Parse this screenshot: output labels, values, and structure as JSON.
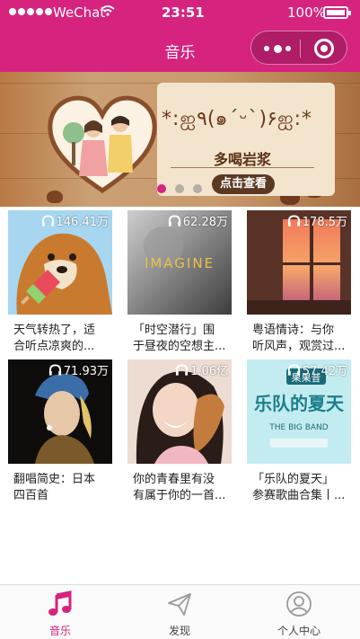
{
  "status_bar": {
    "carrier": "WeChat",
    "time": "23:51",
    "battery": "100%"
  },
  "nav": {
    "title": "音乐"
  },
  "banner": {
    "kaomoji": "*:ஐ٩(๑´ᵕ`)۶ஐ:*",
    "slogan": "多喝岩浆",
    "cta": "点击查看",
    "dots_total": 3,
    "dot_active": 0
  },
  "playlists": [
    {
      "count": "146.41万",
      "line1": "天气转热了，适",
      "line2": "合听点凉爽的...",
      "cover": "dog-popsicle"
    },
    {
      "count": "62.28万",
      "line1": "「时空潜行」围",
      "line2": "于昼夜的空想主...",
      "cover": "imagine-bw"
    },
    {
      "count": "178.5万",
      "line1": "粤语情诗：与你",
      "line2": "听风声，观赏过...",
      "cover": "sunset-window"
    },
    {
      "count": "71.93万",
      "line1": "翻唱简史：日本",
      "line2": "四百首",
      "cover": "pearl-earring"
    },
    {
      "count": "1.06亿",
      "line1": "你的青春里有没",
      "line2": "有属于你的一首...",
      "cover": "girl-laughing"
    },
    {
      "count": "57.42万",
      "line1": "「乐队的夏天」",
      "line2": "参赛歌曲合集丨...",
      "cover": "big-band"
    }
  ],
  "cover_texts": {
    "imagine": "IMAGINE",
    "band_brand": "果果昔",
    "band_title": "乐队的夏天",
    "band_sub": "THE BIG BAND"
  },
  "tabbar": {
    "items": [
      {
        "label": "音乐",
        "icon": "music-note-icon",
        "active": true
      },
      {
        "label": "发现",
        "icon": "paper-plane-icon",
        "active": false
      },
      {
        "label": "个人中心",
        "icon": "user-circle-icon",
        "active": false
      }
    ]
  },
  "colors": {
    "brand": "#d6237e",
    "tab_inactive": "#9a9a9a"
  }
}
